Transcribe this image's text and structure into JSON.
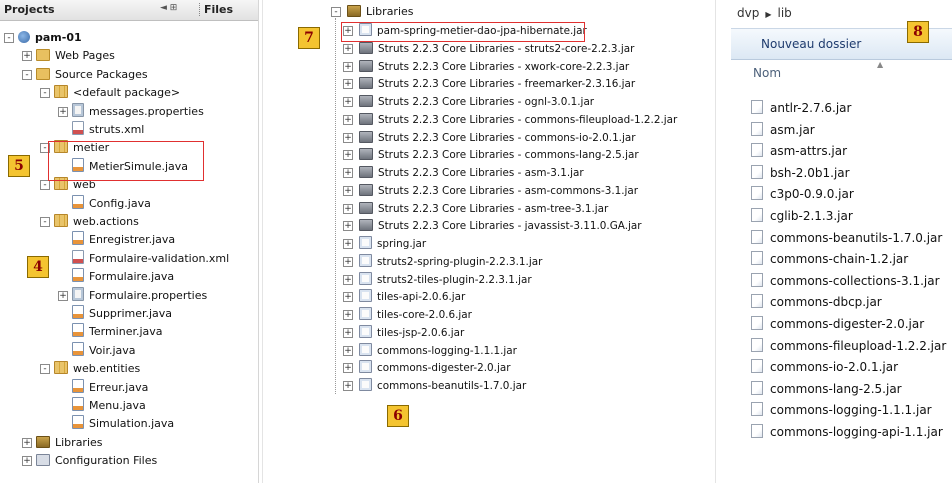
{
  "projects_panel": {
    "tab_projects": "Projects",
    "tab_controls": "◄ ⊞",
    "tab_files": "Files",
    "tree": [
      {
        "label": "pam-01",
        "icon": "project-icon",
        "bold": true
      },
      {
        "label": "Web Pages",
        "icon": "folder-icon"
      },
      {
        "label": "Source Packages",
        "icon": "folder-icon"
      },
      {
        "label": "<default package>",
        "icon": "package-icon"
      },
      {
        "label": "messages.properties",
        "icon": "properties-file-icon"
      },
      {
        "label": "struts.xml",
        "icon": "xml-file-icon"
      },
      {
        "label": "metier",
        "icon": "package-icon"
      },
      {
        "label": "MetierSimule.java",
        "icon": "java-file-icon"
      },
      {
        "label": "web",
        "icon": "package-icon"
      },
      {
        "label": "Config.java",
        "icon": "java-file-icon"
      },
      {
        "label": "web.actions",
        "icon": "package-icon"
      },
      {
        "label": "Enregistrer.java",
        "icon": "java-file-icon"
      },
      {
        "label": "Formulaire-validation.xml",
        "icon": "xml-file-icon"
      },
      {
        "label": "Formulaire.java",
        "icon": "java-file-icon"
      },
      {
        "label": "Formulaire.properties",
        "icon": "properties-file-icon"
      },
      {
        "label": "Supprimer.java",
        "icon": "java-file-icon"
      },
      {
        "label": "Terminer.java",
        "icon": "java-file-icon"
      },
      {
        "label": "Voir.java",
        "icon": "java-file-icon"
      },
      {
        "label": "web.entities",
        "icon": "package-icon"
      },
      {
        "label": "Erreur.java",
        "icon": "java-file-icon"
      },
      {
        "label": "Menu.java",
        "icon": "java-file-icon"
      },
      {
        "label": "Simulation.java",
        "icon": "java-file-icon"
      },
      {
        "label": "Libraries",
        "icon": "libraries-icon"
      },
      {
        "label": "Configuration Files",
        "icon": "config-files-icon"
      }
    ],
    "badge_5": "5",
    "badge_4": "4"
  },
  "libraries_panel": {
    "root": "Libraries",
    "items": [
      {
        "label": "pam-spring-metier-dao-jpa-hibernate.jar",
        "icon": "jar-file-icon"
      },
      {
        "label": "Struts 2.2.3 Core Libraries - struts2-core-2.2.3.jar",
        "icon": "jar-library-icon"
      },
      {
        "label": "Struts 2.2.3 Core Libraries - xwork-core-2.2.3.jar",
        "icon": "jar-library-icon"
      },
      {
        "label": "Struts 2.2.3 Core Libraries - freemarker-2.3.16.jar",
        "icon": "jar-library-icon"
      },
      {
        "label": "Struts 2.2.3 Core Libraries - ognl-3.0.1.jar",
        "icon": "jar-library-icon"
      },
      {
        "label": "Struts 2.2.3 Core Libraries - commons-fileupload-1.2.2.jar",
        "icon": "jar-library-icon"
      },
      {
        "label": "Struts 2.2.3 Core Libraries - commons-io-2.0.1.jar",
        "icon": "jar-library-icon"
      },
      {
        "label": "Struts 2.2.3 Core Libraries - commons-lang-2.5.jar",
        "icon": "jar-library-icon"
      },
      {
        "label": "Struts 2.2.3 Core Libraries - asm-3.1.jar",
        "icon": "jar-library-icon"
      },
      {
        "label": "Struts 2.2.3 Core Libraries - asm-commons-3.1.jar",
        "icon": "jar-library-icon"
      },
      {
        "label": "Struts 2.2.3 Core Libraries - asm-tree-3.1.jar",
        "icon": "jar-library-icon"
      },
      {
        "label": "Struts 2.2.3 Core Libraries - javassist-3.11.0.GA.jar",
        "icon": "jar-library-icon"
      },
      {
        "label": "spring.jar",
        "icon": "jar-file-icon"
      },
      {
        "label": "struts2-spring-plugin-2.2.3.1.jar",
        "icon": "jar-file-icon"
      },
      {
        "label": "struts2-tiles-plugin-2.2.3.1.jar",
        "icon": "jar-file-icon"
      },
      {
        "label": "tiles-api-2.0.6.jar",
        "icon": "jar-file-icon"
      },
      {
        "label": "tiles-core-2.0.6.jar",
        "icon": "jar-file-icon"
      },
      {
        "label": "tiles-jsp-2.0.6.jar",
        "icon": "jar-file-icon"
      },
      {
        "label": "commons-logging-1.1.1.jar",
        "icon": "jar-file-icon"
      },
      {
        "label": "commons-digester-2.0.jar",
        "icon": "jar-file-icon"
      },
      {
        "label": "commons-beanutils-1.7.0.jar",
        "icon": "jar-file-icon"
      }
    ],
    "badge_7": "7",
    "badge_6": "6"
  },
  "explorer_panel": {
    "breadcrumb": [
      "dvp",
      "lib"
    ],
    "new_folder": "Nouveau dossier",
    "col_name": "Nom",
    "files": [
      "antlr-2.7.6.jar",
      "asm.jar",
      "asm-attrs.jar",
      "bsh-2.0b1.jar",
      "c3p0-0.9.0.jar",
      "cglib-2.1.3.jar",
      "commons-beanutils-1.7.0.jar",
      "commons-chain-1.2.jar",
      "commons-collections-3.1.jar",
      "commons-dbcp.jar",
      "commons-digester-2.0.jar",
      "commons-fileupload-1.2.2.jar",
      "commons-io-2.0.1.jar",
      "commons-lang-2.5.jar",
      "commons-logging-1.1.1.jar",
      "commons-logging-api-1.1.jar"
    ],
    "badge_8": "8"
  },
  "colors": {
    "highlight_box": "#e03030",
    "badge_fill": "#f4c430",
    "badge_text": "#8b0000"
  }
}
